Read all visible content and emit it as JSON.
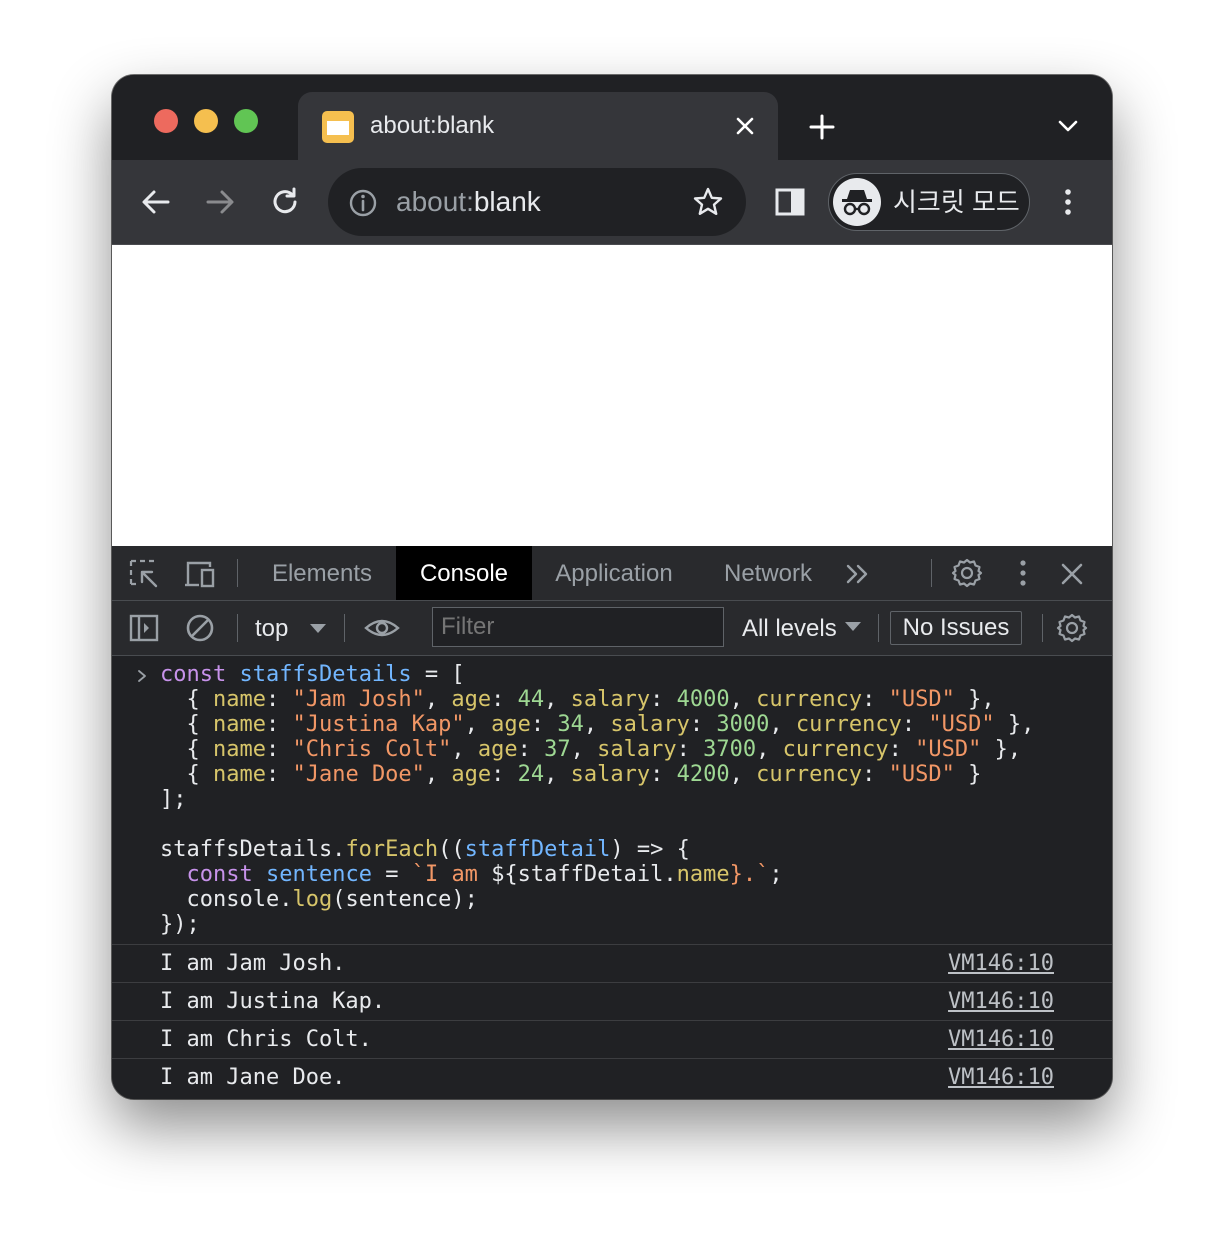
{
  "browser": {
    "tab": {
      "title": "about:blank"
    },
    "omnibox": {
      "url_prefix": "about:",
      "url_host": "blank"
    },
    "incognito_label": "시크릿 모드"
  },
  "devtools": {
    "tabs": [
      "Elements",
      "Console",
      "Application",
      "Network"
    ],
    "active_tab": "Console",
    "console_bar": {
      "context": "top",
      "filter_placeholder": "Filter",
      "levels": "All levels",
      "issues": "No Issues"
    },
    "input_code": {
      "line1": {
        "kw": "const",
        "var": "staffsDetails",
        "rest": " = ["
      },
      "rows": [
        {
          "name": "\"Jam Josh\"",
          "age": "44",
          "salary": "4000",
          "currency": "\"USD\"",
          "end": " },"
        },
        {
          "name": "\"Justina Kap\"",
          "age": "34",
          "salary": "3000",
          "currency": "\"USD\"",
          "end": " },"
        },
        {
          "name": "\"Chris Colt\"",
          "age": "37",
          "salary": "3700",
          "currency": "\"USD\"",
          "end": " },"
        },
        {
          "name": "\"Jane Doe\"",
          "age": "24",
          "salary": "4200",
          "currency": "\"USD\"",
          "end": " }"
        }
      ],
      "close_array": "];",
      "loop": {
        "obj": "staffsDetails.",
        "method": "forEach",
        "param": "staffDetail",
        "arrow": ") => {",
        "kw": "const",
        "var": "sentence",
        "tpl_start": "`I am ",
        "tpl_expr": "${staffDetail.",
        "tpl_prop": "name",
        "tpl_end": "}.`",
        "log_obj": "console.",
        "log_fn": "log",
        "log_arg": "(sentence);",
        "close": "});"
      }
    },
    "logs": [
      {
        "message": "I am Jam Josh.",
        "source": "VM146:10"
      },
      {
        "message": "I am Justina Kap.",
        "source": "VM146:10"
      },
      {
        "message": "I am Chris Colt.",
        "source": "VM146:10"
      },
      {
        "message": "I am Jane Doe.",
        "source": "VM146:10"
      }
    ]
  },
  "colors": {
    "keyword": "#c792ea",
    "variable": "#72b6ff",
    "property": "#d7c56a",
    "string": "#f29766",
    "number": "#9ed893"
  },
  "icons": [
    "traffic-lights",
    "tab-favicon",
    "tab-close-icon",
    "new-tab-icon",
    "tab-search-icon",
    "back-icon",
    "forward-icon",
    "reload-icon",
    "info-icon",
    "star-icon",
    "side-panel-icon",
    "incognito-icon",
    "kebab-menu-icon",
    "inspect-icon",
    "device-toggle-icon",
    "more-tabs-icon",
    "settings-icon",
    "close-icon",
    "sidebar-icon",
    "clear-console-icon",
    "eye-icon",
    "dropdown-icon",
    "console-settings-icon",
    "prompt-chevron-icon"
  ]
}
